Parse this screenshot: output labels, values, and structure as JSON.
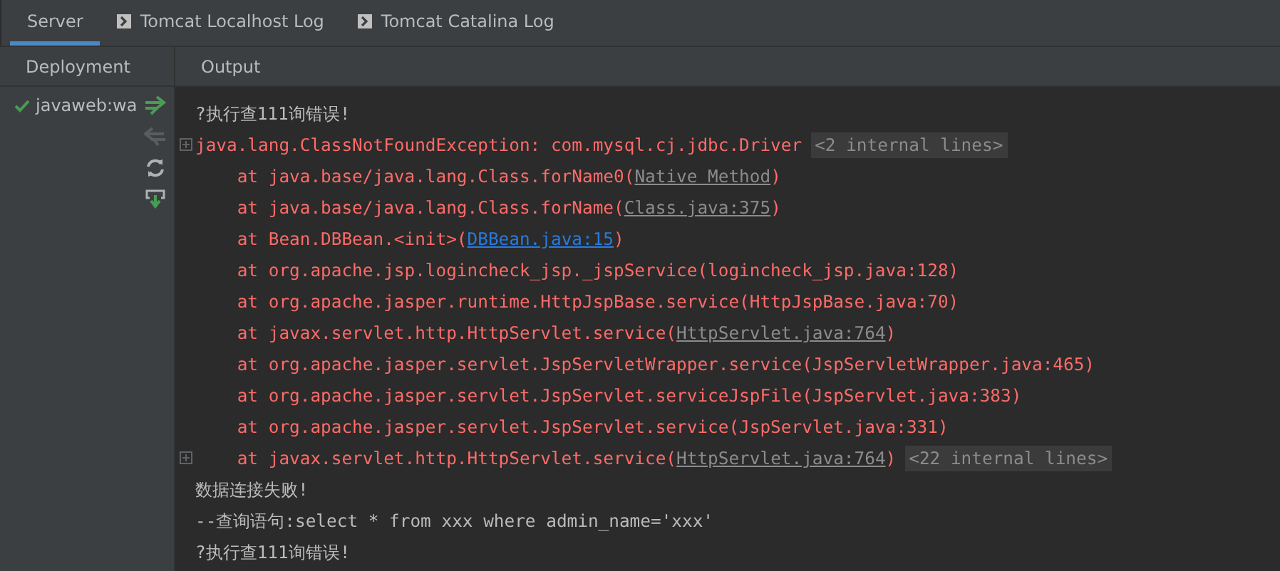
{
  "tabs": [
    {
      "label": "Server",
      "selected": true,
      "icon": false
    },
    {
      "label": "Tomcat Localhost Log",
      "selected": false,
      "icon": true
    },
    {
      "label": "Tomcat Catalina Log",
      "selected": false,
      "icon": true
    }
  ],
  "deployment": {
    "title": "Deployment",
    "items": [
      {
        "label": "javaweb:wa",
        "deployed": true
      }
    ]
  },
  "output": {
    "title": "Output",
    "lines": [
      {
        "fold": false,
        "segments": [
          {
            "kind": "plain",
            "text": "?执行查111询错误!"
          }
        ]
      },
      {
        "fold": true,
        "segments": [
          {
            "kind": "error",
            "text": "java.lang.ClassNotFoundException: com.mysql.cj.jdbc.Driver"
          },
          {
            "kind": "hint",
            "text": "<2 internal lines>"
          }
        ]
      },
      {
        "fold": false,
        "segments": [
          {
            "kind": "error",
            "text": "    at java.base/java.lang.Class.forName0("
          },
          {
            "kind": "muted-link",
            "text": "Native Method"
          },
          {
            "kind": "error",
            "text": ")"
          }
        ]
      },
      {
        "fold": false,
        "segments": [
          {
            "kind": "error",
            "text": "    at java.base/java.lang.Class.forName("
          },
          {
            "kind": "muted-link",
            "text": "Class.java:375"
          },
          {
            "kind": "error",
            "text": ")"
          }
        ]
      },
      {
        "fold": false,
        "segments": [
          {
            "kind": "error",
            "text": "    at Bean.DBBean.<init>("
          },
          {
            "kind": "link",
            "text": "DBBean.java:15"
          },
          {
            "kind": "error",
            "text": ")"
          }
        ]
      },
      {
        "fold": false,
        "segments": [
          {
            "kind": "error",
            "text": "    at org.apache.jsp.logincheck_jsp._jspService(logincheck_jsp.java:128)"
          }
        ]
      },
      {
        "fold": false,
        "segments": [
          {
            "kind": "error",
            "text": "    at org.apache.jasper.runtime.HttpJspBase.service(HttpJspBase.java:70)"
          }
        ]
      },
      {
        "fold": false,
        "segments": [
          {
            "kind": "error",
            "text": "    at javax.servlet.http.HttpServlet.service("
          },
          {
            "kind": "muted-link",
            "text": "HttpServlet.java:764"
          },
          {
            "kind": "error",
            "text": ")"
          }
        ]
      },
      {
        "fold": false,
        "segments": [
          {
            "kind": "error",
            "text": "    at org.apache.jasper.servlet.JspServletWrapper.service(JspServletWrapper.java:465)"
          }
        ]
      },
      {
        "fold": false,
        "segments": [
          {
            "kind": "error",
            "text": "    at org.apache.jasper.servlet.JspServlet.serviceJspFile(JspServlet.java:383)"
          }
        ]
      },
      {
        "fold": false,
        "segments": [
          {
            "kind": "error",
            "text": "    at org.apache.jasper.servlet.JspServlet.service(JspServlet.java:331)"
          }
        ]
      },
      {
        "fold": true,
        "segments": [
          {
            "kind": "error",
            "text": "    at javax.servlet.http.HttpServlet.service("
          },
          {
            "kind": "muted-link",
            "text": "HttpServlet.java:764"
          },
          {
            "kind": "error",
            "text": ")"
          },
          {
            "kind": "hint",
            "text": "<22 internal lines>"
          }
        ]
      },
      {
        "fold": false,
        "segments": [
          {
            "kind": "plain",
            "text": "数据连接失败!"
          }
        ]
      },
      {
        "fold": false,
        "segments": [
          {
            "kind": "plain",
            "text": "--查询语句:select * from xxx where admin_name='xxx'"
          }
        ]
      },
      {
        "fold": false,
        "segments": [
          {
            "kind": "plain",
            "text": "?执行查111询错误!"
          }
        ]
      }
    ]
  }
}
